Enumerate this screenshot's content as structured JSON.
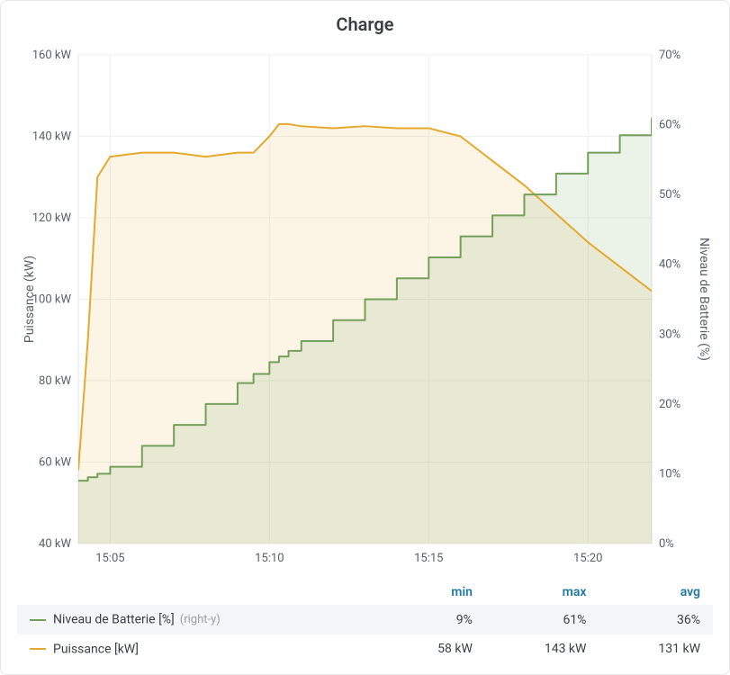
{
  "title": "Charge",
  "axes": {
    "left": {
      "label": "Puissance (kW)",
      "min": 40,
      "max": 160,
      "step": 20,
      "unit": " kW"
    },
    "right": {
      "label": "Niveau de Batterie (%)",
      "min": 0,
      "max": 70,
      "step": 10,
      "unit": "%"
    },
    "x": {
      "ticks": [
        "15:05",
        "15:10",
        "15:15",
        "15:20"
      ],
      "minMin": 244,
      "maxMin": 262
    }
  },
  "legend": {
    "headers": [
      "",
      "min",
      "max",
      "avg"
    ],
    "rows": [
      {
        "color": "#74a05b",
        "name": "Niveau de Batterie [%]",
        "side": "(right-y)",
        "min": "9%",
        "max": "61%",
        "avg": "36%"
      },
      {
        "color": "#e4a92f",
        "name": "Puissance [kW]",
        "side": "",
        "min": "58 kW",
        "max": "143 kW",
        "avg": "131 kW"
      }
    ]
  },
  "chart_data": {
    "type": "line",
    "x_time_minutes": [
      244.0,
      244.3,
      244.6,
      245,
      246,
      247,
      248,
      249,
      249.5,
      250,
      250.3,
      250.6,
      251,
      252,
      253,
      254,
      255,
      256,
      257,
      258,
      259,
      260,
      261,
      262
    ],
    "series": [
      {
        "name": "Puissance [kW]",
        "axis": "left",
        "color": "#e4a92f",
        "fill": "rgba(228,169,47,0.12)",
        "values": [
          58,
          90,
          130,
          135,
          136,
          136,
          135,
          136,
          136,
          140,
          143,
          143,
          142.5,
          142,
          142.5,
          142,
          142,
          140,
          134,
          128,
          121,
          114,
          108,
          102
        ]
      },
      {
        "name": "Niveau de Batterie [%]",
        "axis": "right",
        "color": "#74a05b",
        "fill": "rgba(116,160,91,0.14)",
        "stepped": true,
        "values": [
          9,
          9.5,
          10,
          11,
          14,
          17,
          20,
          23,
          24.3,
          26,
          26.8,
          27.6,
          29,
          32,
          35,
          38,
          41,
          44,
          47,
          50,
          53,
          56,
          58.5,
          61
        ]
      }
    ],
    "title": "Charge",
    "xlabel": "",
    "ylabel_left": "Puissance (kW)",
    "ylabel_right": "Niveau de Batterie (%)"
  }
}
